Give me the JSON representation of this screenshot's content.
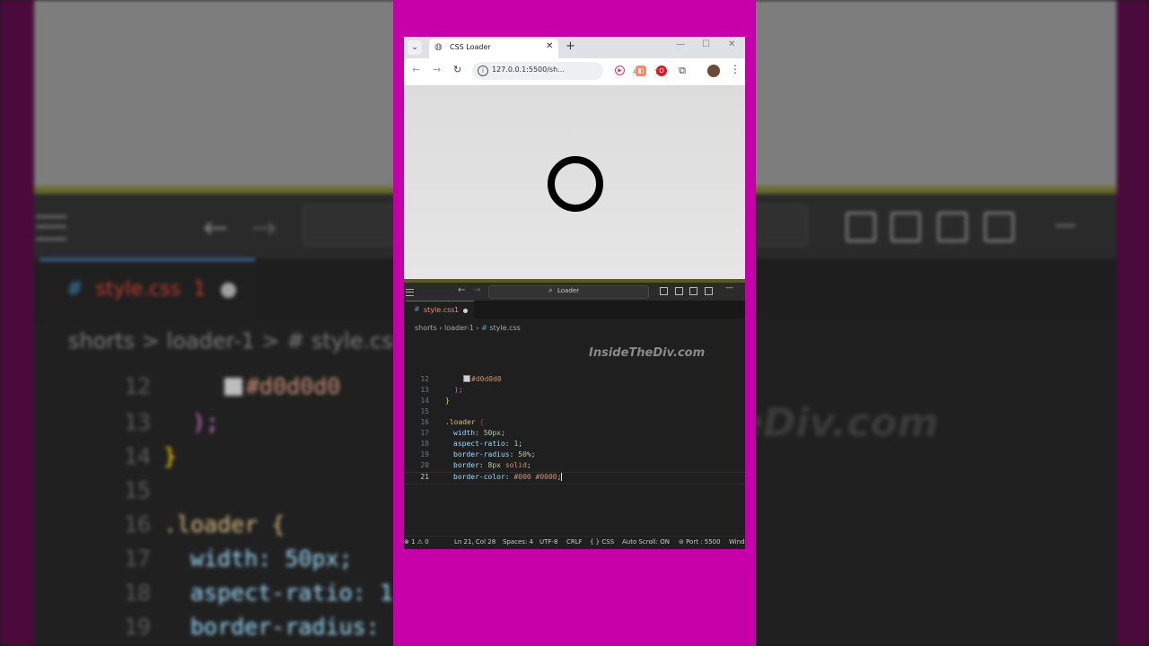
{
  "background": {
    "tab_name": "style.css",
    "tab_error_count": "1",
    "breadcrumb": "shorts > loader-1 >  #  style.css",
    "lines": [
      {
        "number": "12",
        "text": "#d0d0d0"
      },
      {
        "number": "13",
        "text": ");"
      },
      {
        "number": "14",
        "text": "}"
      },
      {
        "number": "15",
        "text": ""
      },
      {
        "number": "16",
        "text": ".loader {"
      },
      {
        "number": "17",
        "text": "width: 50px;"
      },
      {
        "number": "18",
        "text": "aspect-ratio: 1"
      },
      {
        "number": "19",
        "text": "border-radius:"
      }
    ],
    "watermark": "eDiv.com"
  },
  "browser": {
    "tab_title": "CSS Loader",
    "url": "127.0.0.1:5500/sh...",
    "new_tab_symbol": "+"
  },
  "editor": {
    "search_text": "Loader",
    "tab": {
      "name": "style.css",
      "error_count": "1"
    },
    "breadcrumb": {
      "part1": "shorts",
      "part2": "loader-1",
      "file": "style.css"
    },
    "watermark": "InsideTheDiv.com",
    "code_lines": [
      {
        "number": "12",
        "swatch_value": "#d0d0d0"
      },
      {
        "number": "13",
        "text": ");"
      },
      {
        "number": "14",
        "text": "}"
      },
      {
        "number": "15",
        "text": ""
      },
      {
        "number": "16",
        "selector": ".loader",
        "brace": "{"
      },
      {
        "number": "17",
        "prop": "width",
        "value": "50px"
      },
      {
        "number": "18",
        "prop": "aspect-ratio",
        "value": "1"
      },
      {
        "number": "19",
        "prop": "border-radius",
        "value": "50%"
      },
      {
        "number": "20",
        "prop": "border",
        "value_num": "8px",
        "value_kw": "solid"
      },
      {
        "number": "21",
        "prop": "border-color",
        "value": "#000 #0000"
      }
    ]
  },
  "statusbar": {
    "problems": "⊗ 1 ⚠ 0",
    "position": "Ln 21, Col 28",
    "spaces": "Spaces: 4",
    "encoding": "UTF-8",
    "eol": "CRLF",
    "language": "{ } CSS",
    "autoscroll": "Auto Scroll: ON",
    "port": "⊘ Port : 5500",
    "extra": "Wind"
  },
  "colors": {
    "frame_magenta": "#c500a9",
    "editor_bg": "#1f1f1f",
    "error_red": "#f48771",
    "accent_blue": "#3d73b0"
  }
}
